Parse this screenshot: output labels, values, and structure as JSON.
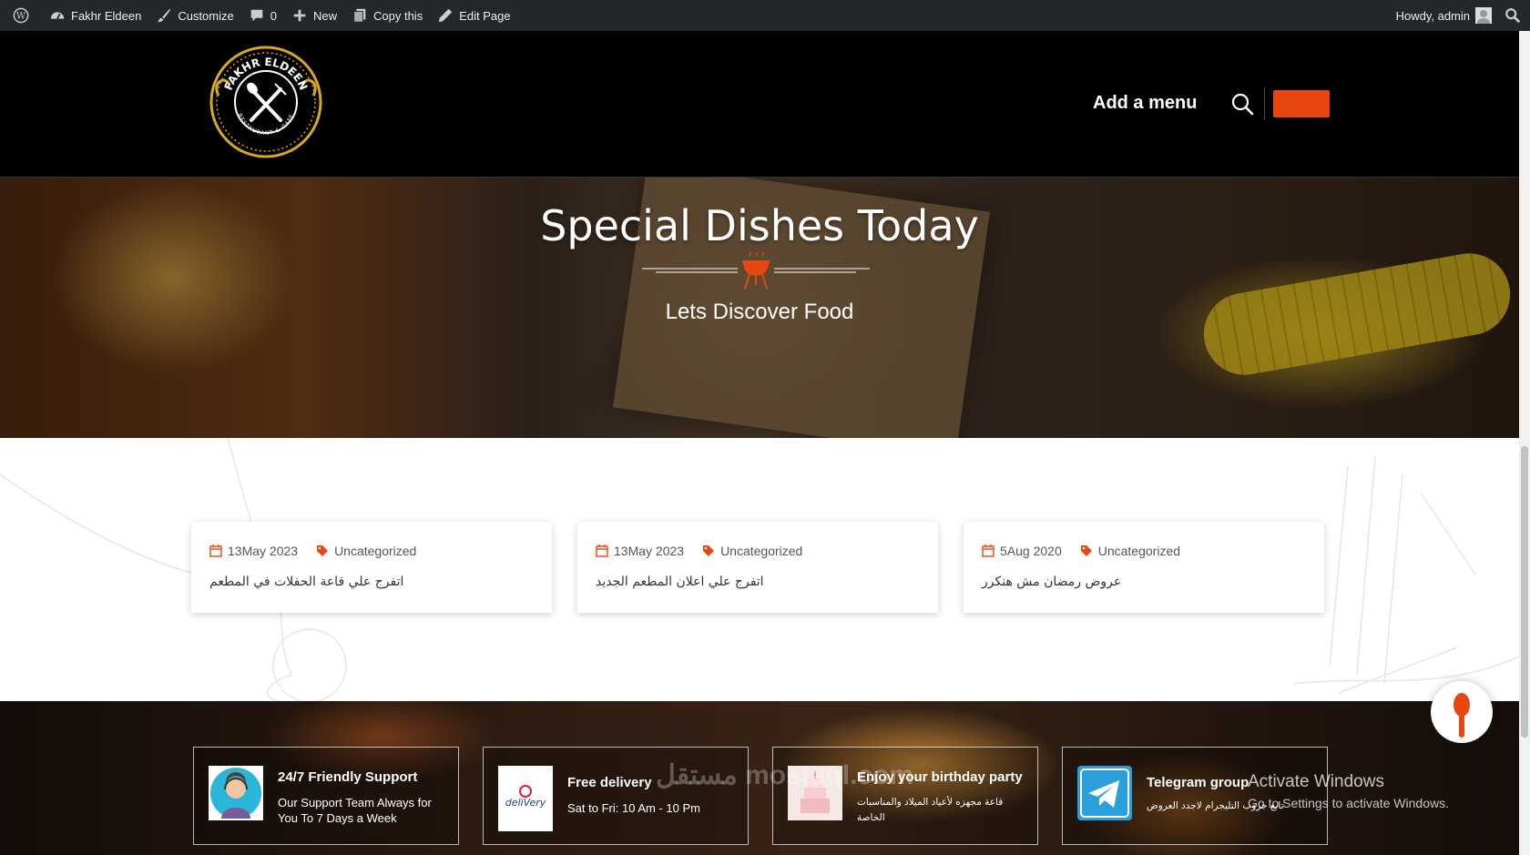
{
  "admin_bar": {
    "site_name": "Fakhr Eldeen",
    "customize": "Customize",
    "comments_count": "0",
    "new": "New",
    "copy": "Copy this",
    "edit": "Edit Page",
    "howdy": "Howdy, admin"
  },
  "header": {
    "logo_text_top": "FAKHR ELDEEN",
    "logo_text_bottom": "RESTAURANT & CAFE",
    "menu_link": "Add a menu",
    "accent_color": "#e8470f"
  },
  "hero": {
    "title": "Special Dishes Today",
    "subtitle": "Lets Discover Food"
  },
  "posts": [
    {
      "date": "13May 2023",
      "category": "Uncategorized",
      "title": "اتفرج علي قاعة الحفلات في المطعم"
    },
    {
      "date": "13May 2023",
      "category": "Uncategorized",
      "title": "اتفرج علي اعلان المطعم الجديد"
    },
    {
      "date": "5Aug 2020",
      "category": "Uncategorized",
      "title": "عروض رمضان مش هنكرر"
    }
  ],
  "features": [
    {
      "title": "24/7 Friendly Support",
      "text": "Our Support Team Always for You To 7 Days a Week",
      "icon": "support-agent-icon"
    },
    {
      "title": "Free delivery",
      "text": "Sat to Fri: 10 Am - 10 Pm",
      "icon": "delivery-logo",
      "logo_text": "deliVery"
    },
    {
      "title": "Enjoy your birthday party",
      "text": "قاعة مجهزه لأعياد الميلاد والمناسبات الخاصة",
      "icon": "birthday-cake-icon"
    },
    {
      "title": "Telegram group",
      "text": "تابع جروب التليجرام لاجدد العروض",
      "icon": "telegram-icon"
    }
  ],
  "watermark": "مستقل mostaql.com",
  "windows_activation": {
    "line1": "Activate Windows",
    "line2": "Go to Settings to activate Windows."
  }
}
